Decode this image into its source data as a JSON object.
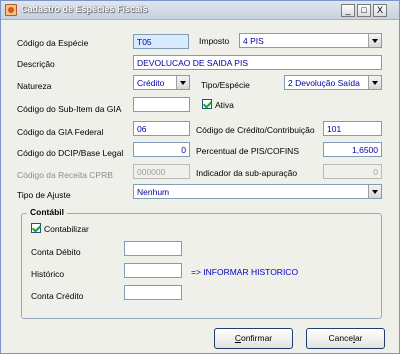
{
  "window": {
    "title": "Cadastro de Espécies Fiscais",
    "minimize": "_",
    "maximize": "□",
    "close": "X"
  },
  "form": {
    "codigo_especie": {
      "label": "Código da Espécie",
      "value": "T05"
    },
    "imposto": {
      "label": "Imposto",
      "value": "4 PIS"
    },
    "descricao": {
      "label": "Descrição",
      "value": "DEVOLUCAO DE SAIDA PIS"
    },
    "natureza": {
      "label": "Natureza",
      "value": "Crédito"
    },
    "tipo_especie": {
      "label": "Tipo/Espécie",
      "value": "2 Devolução Saída"
    },
    "sub_item_gia": {
      "label": "Código do Sub-Item da GIA",
      "value": ""
    },
    "ativa": {
      "label": "Ativa",
      "checked": true
    },
    "gia_federal": {
      "label": "Código da GIA Federal",
      "value": "06"
    },
    "credito_contribuicao": {
      "label": "Código de Crédito/Contribuição",
      "value": "101"
    },
    "dcip_base_legal": {
      "label": "Código do DCIP/Base Legal",
      "value": "0"
    },
    "percentual_pis_cofins": {
      "label": "Percentual de PIS/COFINS",
      "value": "1,6500"
    },
    "receita_cprb": {
      "label": "Código da Receita CPRB",
      "value": "000000"
    },
    "indicador_sub_apuracao": {
      "label": "Indicador da sub-apuração",
      "value": "0"
    },
    "tipo_ajuste": {
      "label": "Tipo de Ajuste",
      "value": "Nenhum"
    }
  },
  "contabil": {
    "title": "Contábil",
    "contabilizar": {
      "label": "Contabilizar",
      "checked": true
    },
    "conta_debito": {
      "label": "Conta Débito",
      "value": ""
    },
    "historico": {
      "label": "Histórico",
      "value": "",
      "hint": "=> INFORMAR HISTORICO"
    },
    "conta_credito": {
      "label": "Conta Crédito",
      "value": ""
    }
  },
  "buttons": {
    "confirmar": {
      "underlined": "C",
      "rest": "onfirmar"
    },
    "cancelar": {
      "prefix": "Cance",
      "underlined": "l",
      "suffix": "ar"
    }
  }
}
